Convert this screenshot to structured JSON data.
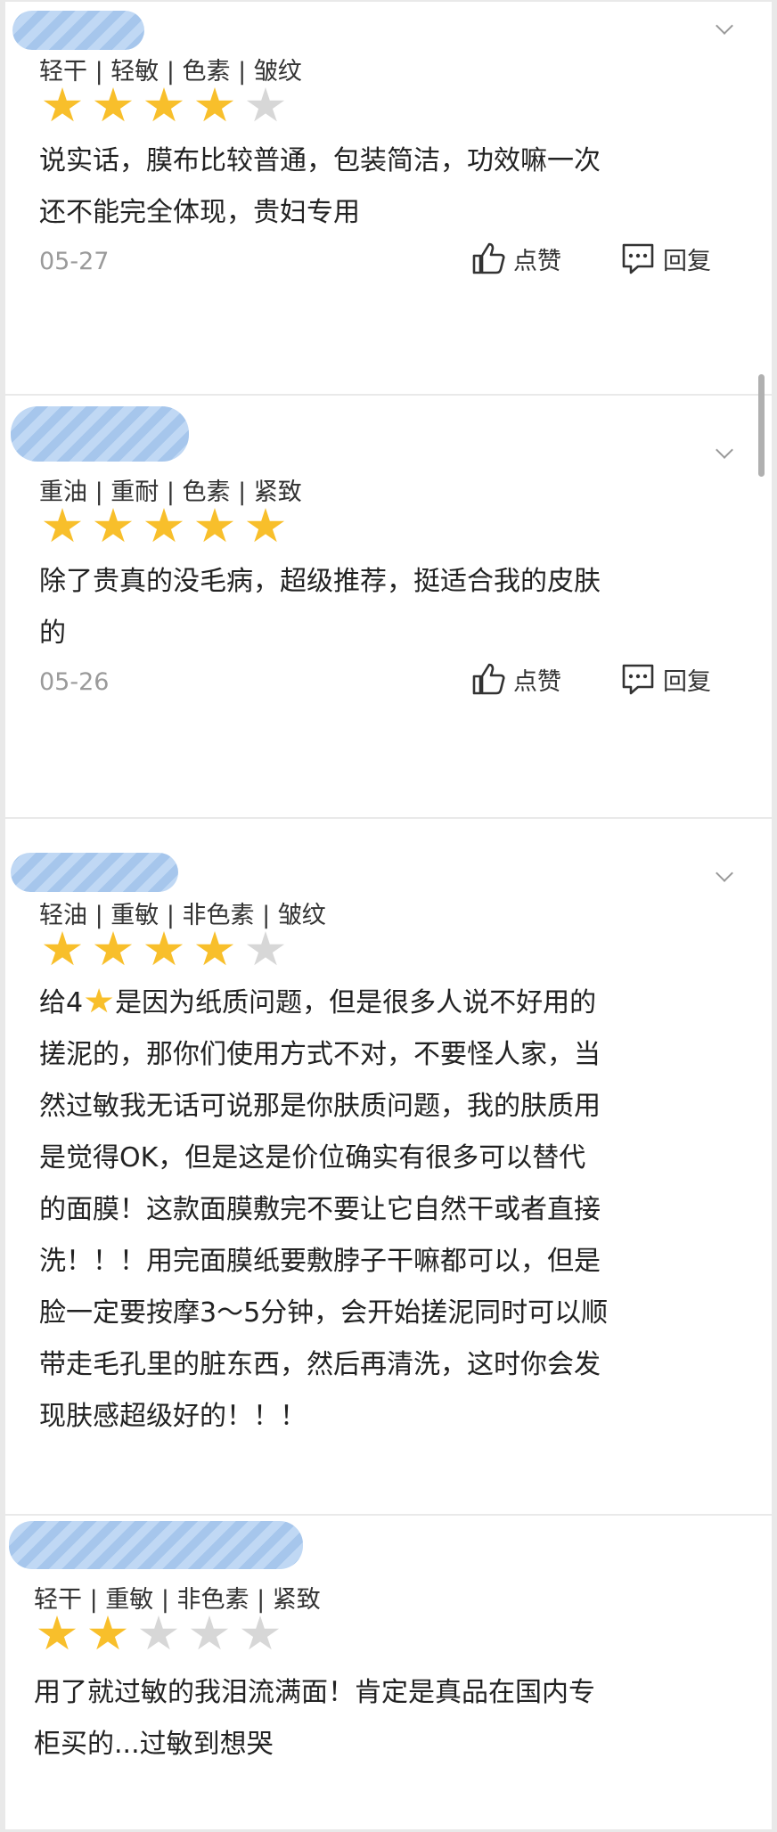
{
  "reviews": [
    {
      "tags": "轻干 | 轻敏 | 色素 | 皱纹",
      "rating": 4,
      "text": "说实话，膜布比较普通，包装简洁，功效嘛一次\n还不能完全体现，贵妇专用",
      "date": "05-27",
      "like_label": "点赞",
      "reply_label": "回复"
    },
    {
      "tags": "重油 | 重耐 | 色素 | 紧致",
      "rating": 5,
      "text": "除了贵真的没毛病，超级推荐，挺适合我的皮肤\n的",
      "date": "05-26",
      "like_label": "点赞",
      "reply_label": "回复"
    },
    {
      "tags": "轻油 | 重敏 | 非色素 | 皱纹",
      "rating": 4,
      "text_prefix": "给4",
      "text": "是因为纸质问题，但是很多人说不好用的\n搓泥的，那你们使用方式不对，不要怪人家，当\n然过敏我无话可说那是你肤质问题，我的肤质用\n是觉得OK，但是这是价位确实有很多可以替代\n的面膜！这款面膜敷完不要让它自然干或者直接\n洗！！！用完面膜纸要敷脖子干嘛都可以，但是\n脸一定要按摩3～5分钟，会开始搓泥同时可以顺\n带走毛孔里的脏东西，然后再清洗，这时你会发\n现肤感超级好的！！！"
    },
    {
      "tags": "轻干 | 重敏 | 非色素 | 紧致",
      "rating": 2,
      "text": "用了就过敏的我泪流满面！肯定是真品在国内专\n柜买的...过敏到想哭"
    }
  ],
  "colors": {
    "star_on": "#f8bf2b",
    "star_off": "#d7d7d7",
    "avatar_mask": "#9cc0ea"
  },
  "icons": [
    "chevron-down-icon",
    "thumbs-up-icon",
    "comment-icon",
    "star-icon"
  ]
}
